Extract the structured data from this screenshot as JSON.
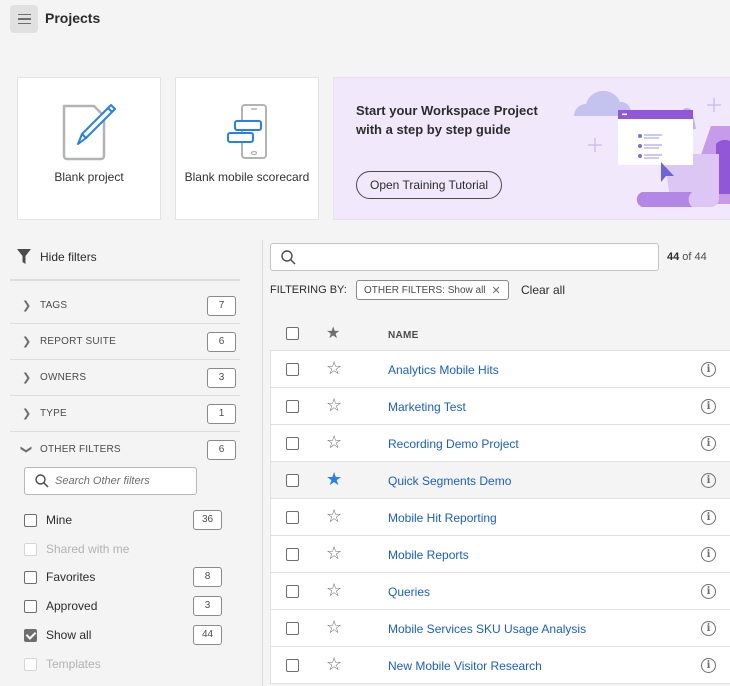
{
  "header": {
    "title": "Projects",
    "menu_icon": "hamburger-menu-icon"
  },
  "templates": [
    {
      "label": "Blank project",
      "icon": "blank-project-icon"
    },
    {
      "label": "Blank mobile scorecard",
      "icon": "mobile-scorecard-icon"
    }
  ],
  "banner": {
    "title": "Start your Workspace Project with a step by step guide",
    "button_label": "Open Training Tutorial",
    "colors": {
      "background": "#f1e9fb",
      "accent": "#9256d9"
    }
  },
  "filters": {
    "toggle_label": "Hide filters",
    "facets": [
      {
        "label": "TAGS",
        "count": "7",
        "expanded": false
      },
      {
        "label": "REPORT SUITE",
        "count": "6",
        "expanded": false
      },
      {
        "label": "OWNERS",
        "count": "3",
        "expanded": false
      },
      {
        "label": "TYPE",
        "count": "1",
        "expanded": false
      },
      {
        "label": "OTHER FILTERS",
        "count": "6",
        "expanded": true
      }
    ],
    "other_search_placeholder": "Search Other filters",
    "options": [
      {
        "label": "Mine",
        "count": "36",
        "checked": false,
        "disabled": false
      },
      {
        "label": "Shared with me",
        "count": "",
        "checked": false,
        "disabled": true
      },
      {
        "label": "Favorites",
        "count": "8",
        "checked": false,
        "disabled": false
      },
      {
        "label": "Approved",
        "count": "3",
        "checked": false,
        "disabled": false
      },
      {
        "label": "Show all",
        "count": "44",
        "checked": true,
        "disabled": false
      },
      {
        "label": "Templates",
        "count": "",
        "checked": false,
        "disabled": true
      }
    ]
  },
  "search": {
    "value": "",
    "placeholder": "",
    "result_shown": "44",
    "result_sep": " of ",
    "result_total": "44"
  },
  "filtering": {
    "label": "FILTERING BY:",
    "chips": [
      {
        "label": "OTHER FILTERS: Show all"
      }
    ],
    "clear_label": "Clear all"
  },
  "table": {
    "columns": {
      "name": "NAME"
    },
    "rows": [
      {
        "name": "Analytics Mobile Hits",
        "favorite": false,
        "highlighted": false
      },
      {
        "name": "Marketing Test",
        "favorite": false,
        "highlighted": false
      },
      {
        "name": "Recording Demo Project",
        "favorite": false,
        "highlighted": false
      },
      {
        "name": "Quick Segments Demo",
        "favorite": true,
        "highlighted": true
      },
      {
        "name": "Mobile Hit Reporting",
        "favorite": false,
        "highlighted": false
      },
      {
        "name": "Mobile Reports",
        "favorite": false,
        "highlighted": false
      },
      {
        "name": "Queries",
        "favorite": false,
        "highlighted": false
      },
      {
        "name": "Mobile Services SKU Usage Analysis",
        "favorite": false,
        "highlighted": false
      },
      {
        "name": "New Mobile Visitor Research",
        "favorite": false,
        "highlighted": false
      }
    ],
    "colors": {
      "link": "#1a5fc7",
      "favorite": "#2680eb"
    }
  }
}
